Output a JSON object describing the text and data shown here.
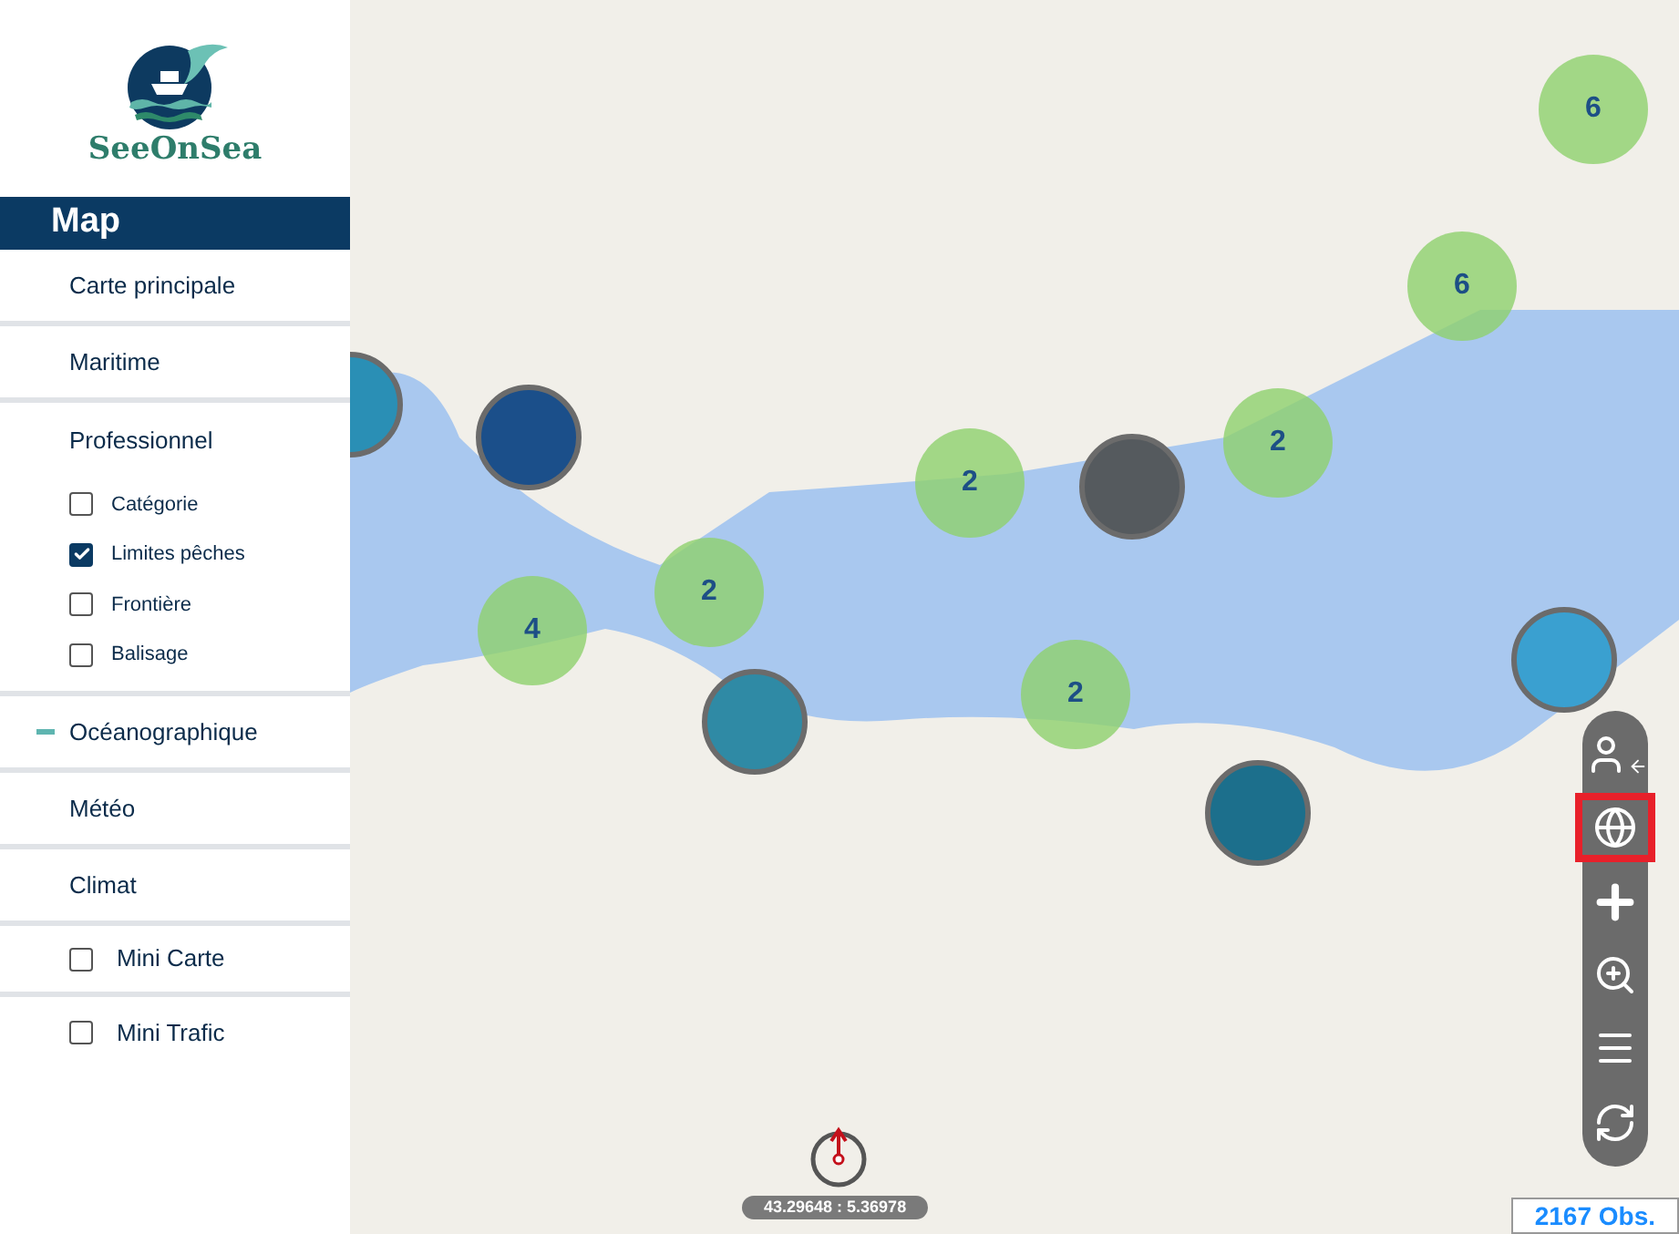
{
  "logo": {
    "text": "SeeOnSea"
  },
  "sidebar": {
    "title": "Map",
    "items": [
      {
        "kind": "link",
        "label": "Carte principale",
        "selected": false
      },
      {
        "kind": "link",
        "label": "Maritime",
        "selected": false
      },
      {
        "kind": "group",
        "label": "Professionnel",
        "children": [
          {
            "label": "Catégorie",
            "checked": false
          },
          {
            "label": "Limites pêches",
            "checked": true
          },
          {
            "label": "Frontière",
            "checked": false
          },
          {
            "label": "Balisage",
            "checked": false
          }
        ]
      },
      {
        "kind": "link",
        "label": "Océanographique",
        "selected": true
      },
      {
        "kind": "link",
        "label": "Météo",
        "selected": false
      },
      {
        "kind": "link",
        "label": "Climat",
        "selected": false
      },
      {
        "kind": "checkbox",
        "label": "Mini Carte",
        "checked": false
      },
      {
        "kind": "checkbox",
        "label": "Mini Trafic",
        "checked": false
      }
    ]
  },
  "map": {
    "clusters": [
      "6",
      "6",
      "2",
      "2",
      "2",
      "4",
      "2"
    ],
    "toolbar": [
      {
        "kind": "user",
        "selected": false
      },
      {
        "kind": "globe",
        "selected": true
      },
      {
        "kind": "plus",
        "selected": false
      },
      {
        "kind": "zoom",
        "selected": false
      },
      {
        "kind": "menu",
        "selected": false
      },
      {
        "kind": "refresh",
        "selected": false
      }
    ],
    "coordinates": "43.29648 : 5.36978",
    "observations": "2167 Obs."
  }
}
